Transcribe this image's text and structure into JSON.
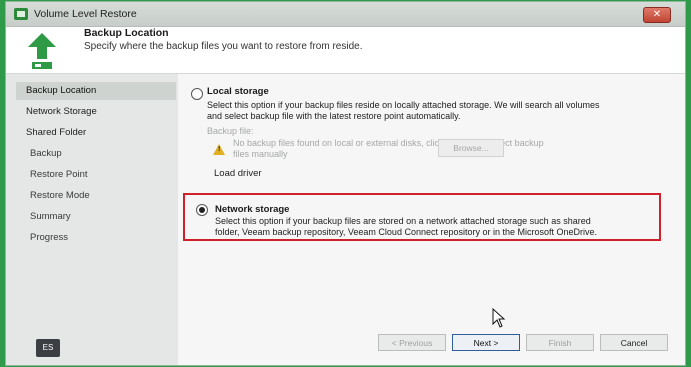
{
  "window": {
    "title": "Volume Level Restore",
    "close": "✕"
  },
  "header": {
    "title": "Backup Location",
    "subtitle": "Specify where the backup files you want to restore from reside."
  },
  "sidebar": {
    "items": [
      {
        "label": "Backup Location"
      },
      {
        "label": "Network Storage"
      },
      {
        "label": "Shared Folder"
      },
      {
        "label": "Backup"
      },
      {
        "label": "Restore Point"
      },
      {
        "label": "Restore Mode"
      },
      {
        "label": "Summary"
      },
      {
        "label": "Progress"
      }
    ],
    "language": "ES"
  },
  "local": {
    "label": "Local storage",
    "desc1": "Select this option if your backup files reside on locally attached storage. We will search all volumes",
    "desc2": "and select backup file with the latest restore point automatically.",
    "backup_file_label": "Backup file:",
    "warning1": "No backup files found on local or external disks, click Browse to select backup",
    "warning2": "files manually",
    "browse": "Browse...",
    "load_driver": "Load driver"
  },
  "network": {
    "label": "Network storage",
    "desc1": "Select this option if your backup files are stored on a network attached storage such as shared",
    "desc2": "folder, Veeam backup repository, Veeam Cloud Connect repository or in the Microsoft OneDrive."
  },
  "buttons": {
    "previous": "< Previous",
    "next": "Next >",
    "finish": "Finish",
    "cancel": "Cancel"
  }
}
